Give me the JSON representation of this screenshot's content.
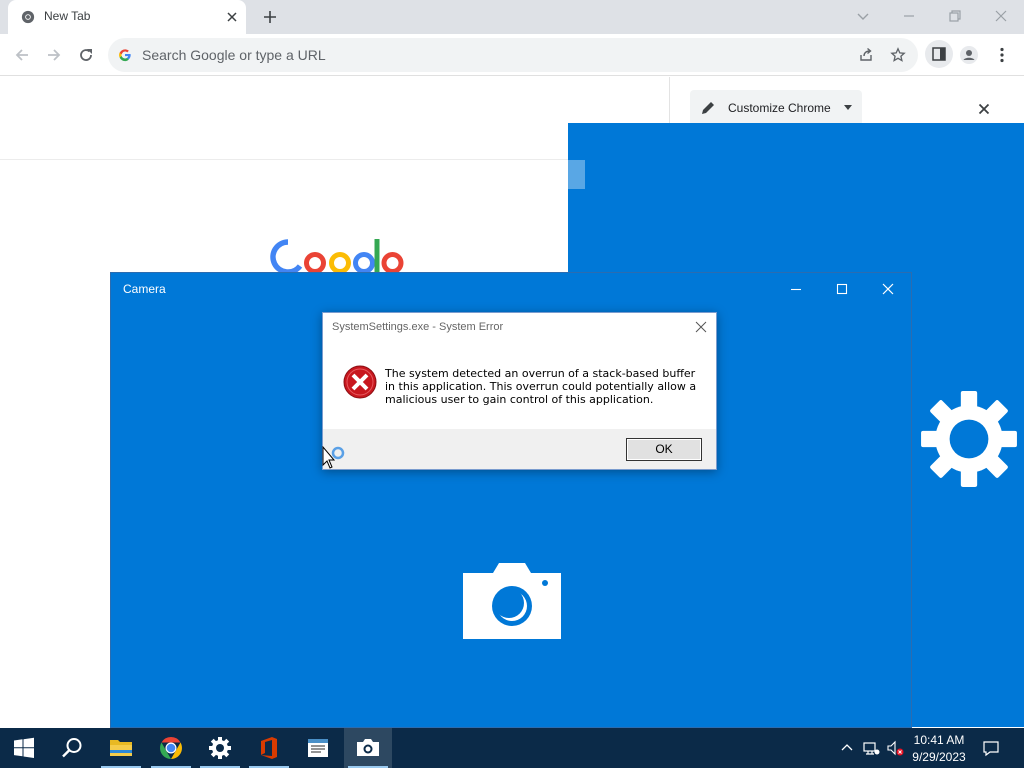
{
  "chrome": {
    "tab_title": "New Tab",
    "omnibox_placeholder": "Search Google or type a URL",
    "side_panel": {
      "customize_label": "Customize Chrome"
    }
  },
  "camera": {
    "title": "Camera"
  },
  "dialog": {
    "title": "SystemSettings.exe - System Error",
    "message": "The system detected an overrun of a stack-based buffer in this application. This overrun could potentially allow a malicious user to gain control of this application.",
    "ok_label": "OK"
  },
  "taskbar": {
    "items": [
      "start-icon",
      "search-icon",
      "file-explorer-icon",
      "chrome-icon",
      "settings-icon",
      "office-icon",
      "notepad-icon",
      "camera-icon"
    ],
    "time": "10:41 AM",
    "date": "9/29/2023"
  },
  "colors": {
    "win_blue": "#0078d7",
    "taskbar": "#0b2a48",
    "error_red": "#c8171e"
  }
}
